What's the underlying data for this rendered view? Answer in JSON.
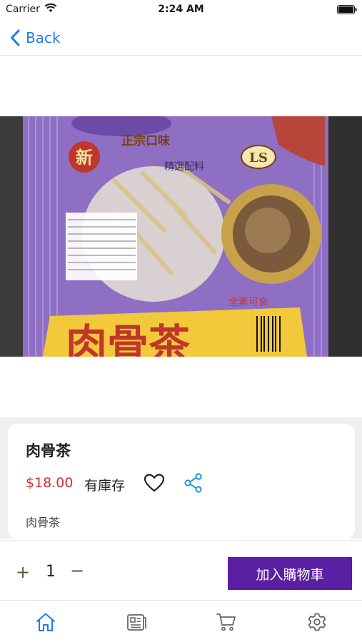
{
  "status_bar": {
    "carrier": "Carrier",
    "time": "2:24 AM"
  },
  "nav": {
    "back_label": "Back"
  },
  "product_image": {
    "icon": "product-photo",
    "package_text": {
      "brand": "新",
      "flavor": "正宗口味",
      "blend": "精選配料",
      "logo": "LS",
      "vegan": "全素可食",
      "name": "肉骨茶"
    }
  },
  "product": {
    "name": "肉骨茶",
    "price": "$18.00",
    "stock_status": "有庫存",
    "description": "肉骨茶"
  },
  "cart": {
    "plus": "+",
    "quantity": "1",
    "minus": "−",
    "add_to_cart_label": "加入購物車"
  },
  "tabs": [
    {
      "icon": "home-icon",
      "active": true
    },
    {
      "icon": "news-icon",
      "active": false
    },
    {
      "icon": "cart-icon",
      "active": false
    },
    {
      "icon": "settings-icon",
      "active": false
    }
  ],
  "colors": {
    "accent_blue": "#1a7cf0",
    "price_red": "#d0302f",
    "button_purple": "#5a1fa3"
  }
}
